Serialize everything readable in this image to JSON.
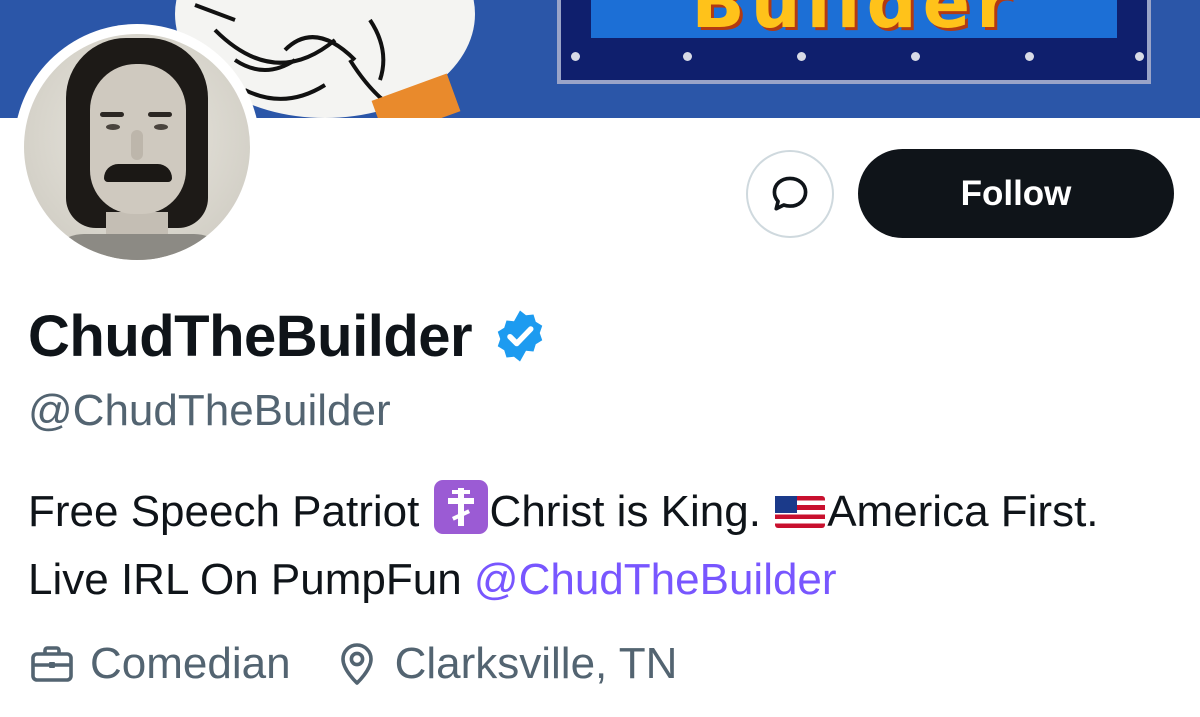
{
  "banner": {
    "sign_text": "Builder"
  },
  "profile": {
    "display_name": "ChudTheBuilder",
    "handle": "@ChudTheBuilder",
    "verified": true,
    "verified_color": "#1d9bf0"
  },
  "actions": {
    "message_icon": "message-bubble-icon",
    "follow_label": "Follow"
  },
  "bio": {
    "part1": "Free Speech Patriot ",
    "emoji1": "orthodox-cross-emoji",
    "part2": "Christ is King. ",
    "emoji2": "us-flag-emoji",
    "part3": "America First. Live IRL On PumpFun ",
    "mention": "@ChudTheBuilder",
    "mention_color": "#7856ff"
  },
  "meta": {
    "profession_icon": "briefcase-icon",
    "profession": "Comedian",
    "location_icon": "location-pin-icon",
    "location": "Clarksville, TN"
  },
  "colors": {
    "text_primary": "#0f1419",
    "text_secondary": "#536471",
    "follow_bg": "#0f1419"
  }
}
